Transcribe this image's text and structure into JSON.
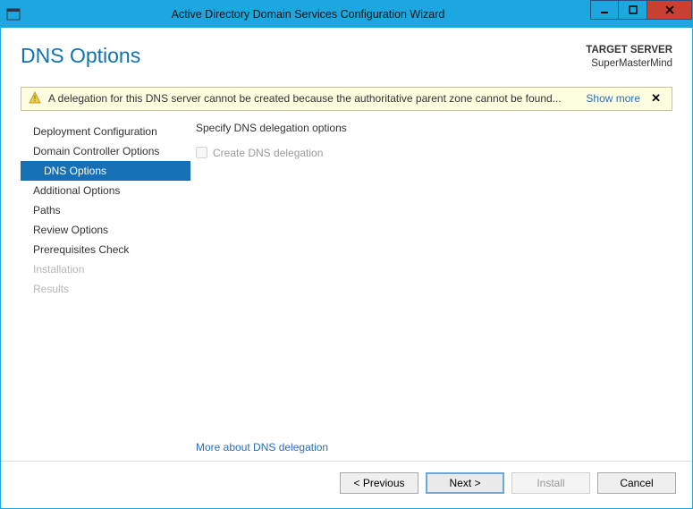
{
  "window": {
    "title": "Active Directory Domain Services Configuration Wizard"
  },
  "header": {
    "page_title": "DNS Options",
    "target_label": "TARGET SERVER",
    "target_server": "SuperMasterMind"
  },
  "warning": {
    "message": "A delegation for this DNS server cannot be created because the authoritative parent zone cannot be found...",
    "show_more": "Show more"
  },
  "sidebar": {
    "items": [
      {
        "label": "Deployment Configuration",
        "state": "normal"
      },
      {
        "label": "Domain Controller Options",
        "state": "normal"
      },
      {
        "label": "DNS Options",
        "state": "active"
      },
      {
        "label": "Additional Options",
        "state": "normal"
      },
      {
        "label": "Paths",
        "state": "normal"
      },
      {
        "label": "Review Options",
        "state": "normal"
      },
      {
        "label": "Prerequisites Check",
        "state": "normal"
      },
      {
        "label": "Installation",
        "state": "disabled"
      },
      {
        "label": "Results",
        "state": "disabled"
      }
    ]
  },
  "main": {
    "spec_label": "Specify DNS delegation options",
    "checkbox_label": "Create DNS delegation",
    "checkbox_checked": false,
    "checkbox_enabled": false,
    "more_link": "More about DNS delegation"
  },
  "footer": {
    "previous": "< Previous",
    "next": "Next >",
    "install": "Install",
    "cancel": "Cancel"
  }
}
